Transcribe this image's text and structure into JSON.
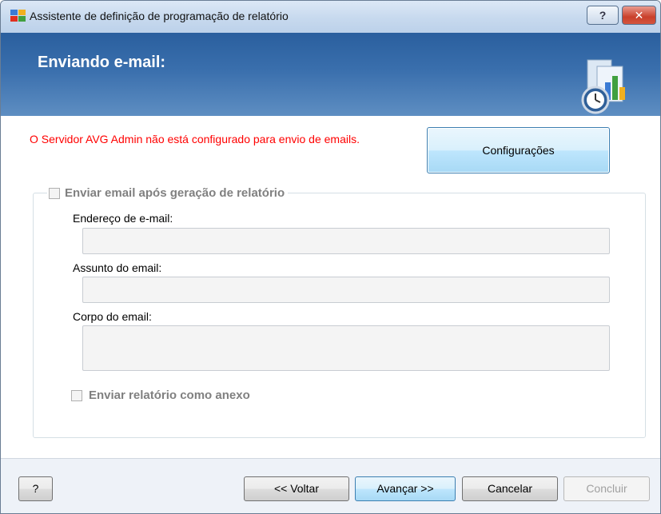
{
  "window": {
    "title": "Assistente de definição de programação de relatório",
    "help_glyph": "?",
    "close_glyph": "✕"
  },
  "header": {
    "title": "Enviando e-mail:",
    "icon": "report-schedule-icon"
  },
  "content": {
    "error_message": "O Servidor AVG Admin não está configurado para envio de emails.",
    "config_button": "Configurações",
    "error_color": "#ff0000",
    "group": {
      "checkbox_label": "Enviar email após geração de relatório",
      "checked": false,
      "email_label": "Endereço de e-mail:",
      "email_value": "",
      "subject_label": "Assunto do email:",
      "subject_value": "",
      "body_label": "Corpo do email:",
      "body_value": "",
      "attach_label": "Enviar relatório como anexo",
      "attach_checked": false
    }
  },
  "footer": {
    "help": "?",
    "back": "<< Voltar",
    "next": "Avançar >>",
    "cancel": "Cancelar",
    "finish": "Concluir"
  }
}
